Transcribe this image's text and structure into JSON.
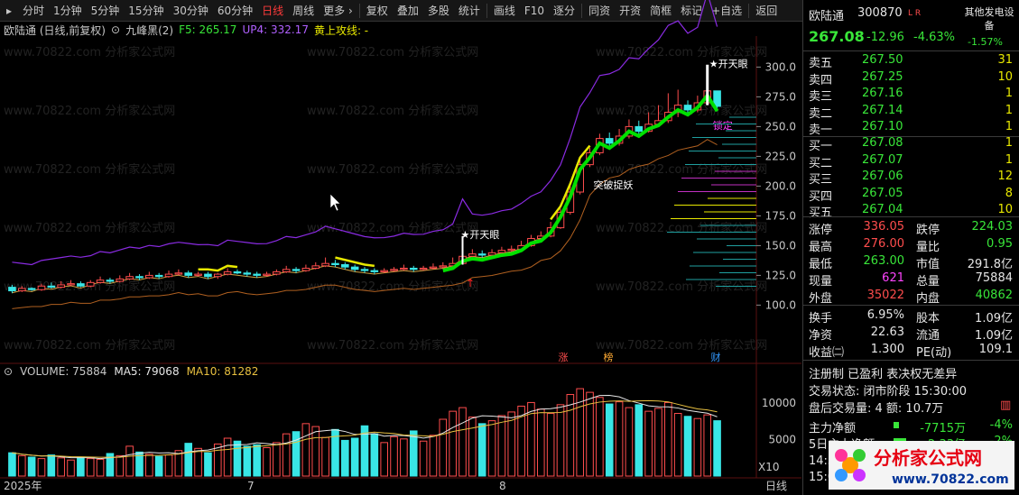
{
  "toolbar": {
    "items": [
      "分时",
      "1分钟",
      "5分钟",
      "15分钟",
      "30分钟",
      "60分钟",
      "日线",
      "周线",
      "更多 ›",
      "复权",
      "叠加",
      "多股",
      "统计",
      "画线",
      "F10",
      "逐分",
      "同资",
      "开资",
      "简框",
      "标记",
      "+自选",
      "返回"
    ],
    "active_index": 6
  },
  "chart_header": {
    "title": "欧陆通 (日线,前复权)",
    "indicator": "九峰黑(2)",
    "f5": "F5: 265.17",
    "up4": "UP4: 332.17",
    "line_label": "黄上攻线: -"
  },
  "price_axis": [
    "300.0",
    "275.0",
    "250.0",
    "225.0",
    "200.0",
    "175.0",
    "150.0",
    "125.0",
    "100.0"
  ],
  "chart_labels": {
    "kaitianyan1": "★开天眼",
    "kaitianyan2": "★开天眼",
    "tupo": "突破捉妖",
    "suoding": "锁定",
    "marker_zhang": "涨",
    "marker_bang": "榜",
    "marker_cai": "财"
  },
  "volume_header": {
    "volume": "VOLUME: 75884",
    "ma5": "MA5: 79068",
    "ma10": "MA10: 81282"
  },
  "volume_axis": [
    "10000",
    "5000"
  ],
  "volume_unit": "X10",
  "time_axis": [
    "2025年",
    "7",
    "8"
  ],
  "period_label": "日线",
  "watermark": "www.70822.com 分析家公式网",
  "stock": {
    "name": "欧陆通",
    "code": "300870",
    "tag": "L R",
    "price": "267.08",
    "change": "-12.96",
    "change_pct": "-4.63%",
    "other_label": "其他发电设备",
    "sector_pct": "-1.57%"
  },
  "asks": [
    {
      "label": "卖五",
      "price": "267.50",
      "vol": "31"
    },
    {
      "label": "卖四",
      "price": "267.25",
      "vol": "10"
    },
    {
      "label": "卖三",
      "price": "267.16",
      "vol": "1"
    },
    {
      "label": "卖二",
      "price": "267.14",
      "vol": "1"
    },
    {
      "label": "卖一",
      "price": "267.10",
      "vol": "1"
    }
  ],
  "bids": [
    {
      "label": "买一",
      "price": "267.08",
      "vol": "1"
    },
    {
      "label": "买二",
      "price": "267.07",
      "vol": "1"
    },
    {
      "label": "买三",
      "price": "267.06",
      "vol": "12"
    },
    {
      "label": "买四",
      "price": "267.05",
      "vol": "8"
    },
    {
      "label": "买五",
      "price": "267.04",
      "vol": "10"
    }
  ],
  "stats": [
    {
      "l1": "涨停",
      "v1": "336.05",
      "c1": "red",
      "l2": "跌停",
      "v2": "224.03",
      "c2": "green"
    },
    {
      "l1": "最高",
      "v1": "276.00",
      "c1": "red",
      "l2": "量比",
      "v2": "0.95",
      "c2": "green"
    },
    {
      "l1": "最低",
      "v1": "263.00",
      "c1": "green",
      "l2": "市值",
      "v2": "291.8亿",
      "c2": "white"
    },
    {
      "l1": "现量",
      "v1": "621",
      "c1": "magenta",
      "l2": "总量",
      "v2": "75884",
      "c2": "white"
    },
    {
      "l1": "外盘",
      "v1": "35022",
      "c1": "red",
      "l2": "内盘",
      "v2": "40862",
      "c2": "green"
    }
  ],
  "fundamentals": [
    {
      "l1": "换手",
      "v1": "6.95%",
      "l2": "股本",
      "v2": "1.09亿"
    },
    {
      "l1": "净资",
      "v1": "22.63",
      "l2": "流通",
      "v2": "1.09亿"
    },
    {
      "l1": "收益㈡",
      "v1": "1.300",
      "l2": "PE(动)",
      "v2": "109.1"
    }
  ],
  "info": {
    "line1": "注册制 已盈利 表决权无差异",
    "line2": "交易状态: 闭市阶段 15:30:00",
    "line3": "盘后交易量: 4  额: 10.7万"
  },
  "flows": [
    {
      "label": "主力净额",
      "value": "-7715万",
      "pct": "-4%"
    },
    {
      "label": "5日主力净额",
      "value": "-2.33亿",
      "pct": "-2%"
    }
  ],
  "time_rows": [
    "14:5",
    "15:0"
  ],
  "logo": {
    "title": "分析家公式网",
    "url": "www.70822.com"
  },
  "colors": {
    "up": "#ff4d4d",
    "down": "#39e6e6",
    "ma_green": "#00e000",
    "ma_yellow": "#e8e800",
    "upper_band": "#8a2be2",
    "up_candle": "#ff3a3a"
  },
  "chart_data": {
    "type": "candlestick",
    "ylim": [
      95,
      320
    ],
    "candles": [
      [
        115,
        112,
        117,
        110
      ],
      [
        112,
        114,
        116,
        111
      ],
      [
        114,
        113,
        115,
        112
      ],
      [
        113,
        116,
        118,
        112
      ],
      [
        116,
        115,
        119,
        114
      ],
      [
        115,
        117,
        120,
        114
      ],
      [
        117,
        118,
        121,
        116
      ],
      [
        118,
        116,
        120,
        115
      ],
      [
        116,
        119,
        121,
        115
      ],
      [
        119,
        121,
        124,
        118
      ],
      [
        121,
        120,
        123,
        118
      ],
      [
        120,
        122,
        125,
        119
      ],
      [
        122,
        124,
        127,
        121
      ],
      [
        124,
        123,
        126,
        121
      ],
      [
        123,
        125,
        128,
        122
      ],
      [
        125,
        124,
        127,
        122
      ],
      [
        124,
        126,
        129,
        123
      ],
      [
        126,
        127,
        130,
        125
      ],
      [
        127,
        125,
        129,
        123
      ],
      [
        125,
        126,
        128,
        124
      ],
      [
        126,
        124,
        128,
        122
      ],
      [
        124,
        126,
        127,
        122
      ],
      [
        126,
        128,
        131,
        125
      ],
      [
        128,
        127,
        130,
        126
      ],
      [
        127,
        126,
        129,
        124
      ],
      [
        126,
        125,
        128,
        123
      ],
      [
        125,
        126,
        128,
        124
      ],
      [
        126,
        128,
        130,
        125
      ],
      [
        128,
        130,
        133,
        127
      ],
      [
        130,
        129,
        132,
        127
      ],
      [
        129,
        131,
        134,
        128
      ],
      [
        131,
        133,
        136,
        130
      ],
      [
        133,
        135,
        140,
        132
      ],
      [
        135,
        134,
        138,
        132
      ],
      [
        134,
        132,
        136,
        130
      ],
      [
        132,
        130,
        134,
        128
      ],
      [
        130,
        129,
        132,
        127
      ],
      [
        129,
        128,
        131,
        126
      ],
      [
        128,
        129,
        131,
        127
      ],
      [
        129,
        130,
        132,
        128
      ],
      [
        130,
        131,
        134,
        129
      ],
      [
        131,
        130,
        133,
        128
      ],
      [
        130,
        131,
        133,
        129
      ],
      [
        131,
        132,
        135,
        130
      ],
      [
        132,
        133,
        136,
        131
      ],
      [
        133,
        135,
        140,
        132
      ],
      [
        135,
        141,
        158,
        134
      ],
      [
        141,
        143,
        147,
        139
      ],
      [
        143,
        142,
        146,
        140
      ],
      [
        142,
        144,
        147,
        141
      ],
      [
        144,
        146,
        149,
        143
      ],
      [
        146,
        147,
        150,
        145
      ],
      [
        147,
        150,
        154,
        146
      ],
      [
        150,
        156,
        159,
        149
      ],
      [
        156,
        158,
        162,
        155
      ],
      [
        158,
        165,
        170,
        157
      ],
      [
        165,
        178,
        181,
        164
      ],
      [
        178,
        195,
        200,
        176
      ],
      [
        195,
        218,
        222,
        193
      ],
      [
        218,
        228,
        232,
        216
      ],
      [
        228,
        240,
        244,
        226
      ],
      [
        240,
        236,
        245,
        232
      ],
      [
        236,
        242,
        248,
        234
      ],
      [
        242,
        250,
        256,
        240
      ],
      [
        250,
        246,
        255,
        243
      ],
      [
        246,
        252,
        262,
        245
      ],
      [
        252,
        255,
        268,
        250
      ],
      [
        255,
        262,
        278,
        253
      ],
      [
        262,
        268,
        281,
        258
      ],
      [
        268,
        264,
        272,
        260
      ],
      [
        264,
        270,
        276,
        262
      ],
      [
        270,
        280,
        300,
        268
      ],
      [
        280,
        267,
        276,
        263
      ]
    ],
    "volumes": [
      3200,
      2800,
      2600,
      2400,
      2900,
      2500,
      2200,
      2600,
      2400,
      2300,
      3100,
      2800,
      4100,
      3300,
      3000,
      2700,
      2900,
      3500,
      4500,
      3800,
      3200,
      4400,
      5200,
      4800,
      4100,
      4300,
      3900,
      4600,
      5800,
      6100,
      7200,
      6800,
      5300,
      6400,
      4900,
      5200,
      6900,
      5800,
      4600,
      5400,
      5100,
      6200,
      4800,
      5600,
      7800,
      8900,
      9400,
      8100,
      7200,
      7600,
      8300,
      8800,
      9600,
      10100,
      9200,
      8600,
      9800,
      11200,
      12000,
      11500,
      10800,
      9900,
      10200,
      9400,
      9800,
      8900,
      9300,
      10100,
      8600,
      8200,
      7900,
      8400,
      7600
    ]
  }
}
